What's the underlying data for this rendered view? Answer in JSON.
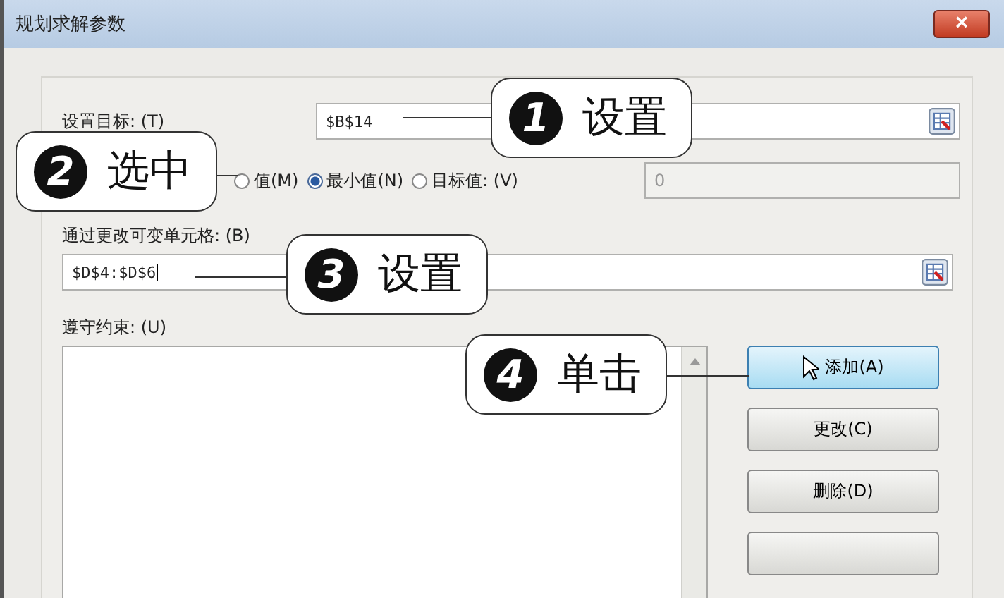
{
  "window": {
    "title": "规划求解参数",
    "close": "×"
  },
  "target": {
    "label": "设置目标: (T)",
    "value": "$B$14"
  },
  "to": {
    "options": [
      {
        "label": "值(M)",
        "selected": false
      },
      {
        "label": "最小值(N)",
        "selected": true
      },
      {
        "label": "目标值: (V)",
        "selected": false
      }
    ],
    "value_field": {
      "value": "0",
      "disabled": true
    }
  },
  "changing": {
    "label": "通过更改可变单元格: (B)",
    "value": "$D$4:$D$6"
  },
  "constraints": {
    "label": "遵守约束: (U)"
  },
  "buttons": [
    {
      "label": "添加(A)",
      "hovered": true
    },
    {
      "label": "更改(C)",
      "hovered": false
    },
    {
      "label": "删除(D)",
      "hovered": false
    },
    {
      "hovered": false
    }
  ],
  "callouts": [
    {
      "number": "1",
      "text": "设置"
    },
    {
      "number": "2",
      "text": "选中"
    },
    {
      "number": "3",
      "text": "设置"
    },
    {
      "number": "4",
      "text": "单击"
    }
  ]
}
